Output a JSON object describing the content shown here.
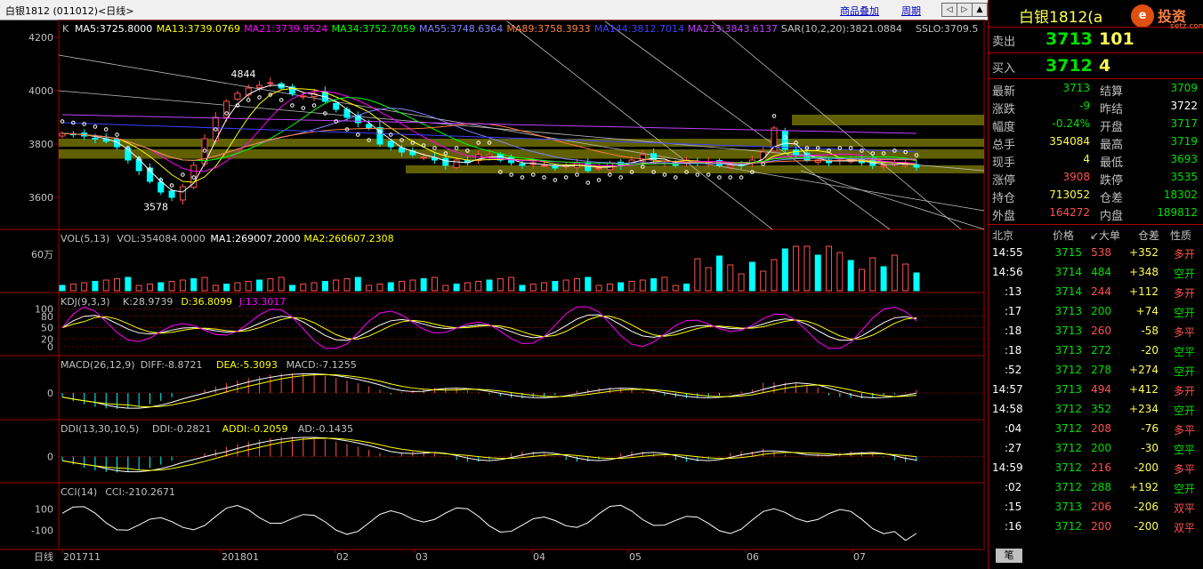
{
  "topbar": {
    "title": "白银1812 (011012)<日线>",
    "btn_overlay": "商品叠加",
    "btn_period": "周期",
    "nav_left": "◁",
    "nav_right": "▷",
    "nav_up": "▲"
  },
  "colors": {
    "up": "#ff5050",
    "down": "#00ffff",
    "ma5": "#ffffff",
    "ma13": "#ffff00",
    "ma21": "#ff00ff",
    "ma34": "#00ff00",
    "ma55": "#8080ff",
    "ma89": "#ff8040",
    "ma144": "#4040ff",
    "ma233": "#c040ff",
    "sar": "#ffffff",
    "ssl": "#ffff00",
    "olive": "#808000"
  },
  "chart_data": [
    {
      "type": "candlestick",
      "panel": "K",
      "indicators": [
        {
          "name": "MA5",
          "value": "3725.8000"
        },
        {
          "name": "MA13",
          "value": "3739.0769"
        },
        {
          "name": "MA21",
          "value": "3739.9524"
        },
        {
          "name": "MA34",
          "value": "3752.7059"
        },
        {
          "name": "MA55",
          "value": "3748.6364"
        },
        {
          "name": "MA89",
          "value": "3758.3933"
        },
        {
          "name": "MA144",
          "value": "3812.7014"
        },
        {
          "name": "MA233",
          "value": "3843.6137"
        },
        {
          "name": "SAR(10,2,20)",
          "value": "3821.0884"
        },
        {
          "name": "SSLO",
          "value": "3709.5"
        }
      ],
      "yticks": [
        3600,
        3800,
        4000,
        4200
      ],
      "ylim": [
        3480,
        4260
      ],
      "annotations": [
        {
          "text": "4844",
          "x": "2018-01",
          "y": 4044
        },
        {
          "text": "3578",
          "x": "2017-12",
          "y": 3578
        }
      ],
      "xticks": [
        "201711",
        "201801",
        "02",
        "03",
        "04",
        "05",
        "06",
        "07"
      ],
      "ohlc_close_approx": [
        3840,
        3835,
        3830,
        3820,
        3810,
        3790,
        3740,
        3700,
        3660,
        3620,
        3600,
        3640,
        3720,
        3820,
        3900,
        3960,
        3990,
        4010,
        4020,
        4030,
        4010,
        3990,
        3980,
        3990,
        3960,
        3930,
        3900,
        3880,
        3860,
        3800,
        3790,
        3770,
        3760,
        3750,
        3740,
        3720,
        3740,
        3730,
        3760,
        3760,
        3740,
        3730,
        3720,
        3730,
        3720,
        3710,
        3720,
        3730,
        3700,
        3710,
        3730,
        3720,
        3740,
        3760,
        3740,
        3730,
        3720,
        3740,
        3730,
        3730,
        3720,
        3720,
        3720,
        3740,
        3770,
        3860,
        3780,
        3760,
        3740,
        3740,
        3730,
        3740,
        3740,
        3730,
        3720,
        3720,
        3730,
        3725,
        3713
      ]
    },
    {
      "type": "bar",
      "panel": "VOL",
      "label": "VOL(5,13)",
      "indicators": [
        {
          "name": "VOL",
          "value": "354084.0000"
        },
        {
          "name": "MA1",
          "value": "269007.2000"
        },
        {
          "name": "MA2",
          "value": "260607.2308"
        }
      ],
      "yticks": [
        "60万"
      ]
    },
    {
      "type": "line",
      "panel": "KDJ",
      "label": "KDJ(9,3,3)",
      "indicators": [
        {
          "name": "K",
          "value": "28.9739"
        },
        {
          "name": "D",
          "value": "36.8099"
        },
        {
          "name": "J",
          "value": "13.3017"
        }
      ],
      "yticks": [
        100,
        80,
        50,
        20,
        0
      ],
      "ylim": [
        -10,
        110
      ]
    },
    {
      "type": "bar",
      "panel": "MACD",
      "label": "MACD(26,12,9)",
      "indicators": [
        {
          "name": "DIFF",
          "value": "-8.8721"
        },
        {
          "name": "DEA",
          "value": "-5.3093"
        },
        {
          "name": "MACD",
          "value": "-7.1255"
        }
      ],
      "yticks": [
        0
      ]
    },
    {
      "type": "bar",
      "panel": "DDI",
      "label": "DDI(13,30,10,5)",
      "indicators": [
        {
          "name": "DDI",
          "value": "-0.2821"
        },
        {
          "name": "ADDI",
          "value": "-0.2059"
        },
        {
          "name": "AD",
          "value": "-0.1435"
        }
      ],
      "yticks": [
        0
      ]
    },
    {
      "type": "line",
      "panel": "CCI",
      "label": "CCI(14)",
      "indicators": [
        {
          "name": "CCI",
          "value": "-210.2671"
        }
      ],
      "yticks": [
        100,
        -100
      ]
    }
  ],
  "bottom": {
    "period_label": "日线"
  },
  "quote": {
    "title": "白银1812(a",
    "logo_text": "投资",
    "logo_small": "setz.com",
    "logo_char": "e",
    "sell_label": "卖出",
    "sell_price": "3713",
    "sell_vol": "101",
    "buy_label": "买入",
    "buy_price": "3712",
    "buy_vol": "4",
    "rows": [
      {
        "l1": "最新",
        "v1": "3713",
        "l2": "结算",
        "v2": "3709"
      },
      {
        "l1": "涨跌",
        "v1": "-9",
        "l2": "昨结",
        "v2": "3722"
      },
      {
        "l1": "幅度",
        "v1": "-0.24%",
        "l2": "开盘",
        "v2": "3717"
      },
      {
        "l1": "总手",
        "v1": "354084",
        "l2": "最高",
        "v2": "3719"
      },
      {
        "l1": "现手",
        "v1": "4",
        "l2": "最低",
        "v2": "3693"
      },
      {
        "l1": "涨停",
        "v1": "3908",
        "l2": "跌停",
        "v2": "3535"
      },
      {
        "l1": "持仓",
        "v1": "713052",
        "l2": "仓差",
        "v2": "18302"
      },
      {
        "l1": "外盘",
        "v1": "164272",
        "l2": "内盘",
        "v2": "189812"
      }
    ],
    "tick_headers": [
      "北京",
      "价格",
      "↙大单",
      "仓差",
      "性质"
    ],
    "ticks": [
      {
        "time": "14:55",
        "price": "3715",
        "vol": "538",
        "oi": "+352",
        "type": "多开"
      },
      {
        "time": "14:56",
        "price": "3714",
        "vol": "484",
        "oi": "+348",
        "type": "空开"
      },
      {
        "time": ":13",
        "price": "3714",
        "vol": "244",
        "oi": "+112",
        "type": "多开"
      },
      {
        "time": ":17",
        "price": "3713",
        "vol": "200",
        "oi": "+74",
        "type": "空开"
      },
      {
        "time": ":18",
        "price": "3713",
        "vol": "260",
        "oi": "-58",
        "type": "多平"
      },
      {
        "time": ":18",
        "price": "3713",
        "vol": "272",
        "oi": "-20",
        "type": "空平"
      },
      {
        "time": ":52",
        "price": "3712",
        "vol": "278",
        "oi": "+274",
        "type": "空开"
      },
      {
        "time": "14:57",
        "price": "3713",
        "vol": "494",
        "oi": "+412",
        "type": "多开"
      },
      {
        "time": "14:58",
        "price": "3712",
        "vol": "352",
        "oi": "+234",
        "type": "空开"
      },
      {
        "time": ":04",
        "price": "3712",
        "vol": "208",
        "oi": "-76",
        "type": "多平"
      },
      {
        "time": ":27",
        "price": "3712",
        "vol": "200",
        "oi": "-30",
        "type": "空平"
      },
      {
        "time": "14:59",
        "price": "3712",
        "vol": "216",
        "oi": "-200",
        "type": "多平"
      },
      {
        "time": ":02",
        "price": "3712",
        "vol": "288",
        "oi": "+192",
        "type": "空开"
      },
      {
        "time": ":15",
        "price": "3713",
        "vol": "206",
        "oi": "-206",
        "type": "双平"
      },
      {
        "time": ":16",
        "price": "3712",
        "vol": "200",
        "oi": "-200",
        "type": "双平"
      }
    ],
    "tab_label": "笔"
  }
}
